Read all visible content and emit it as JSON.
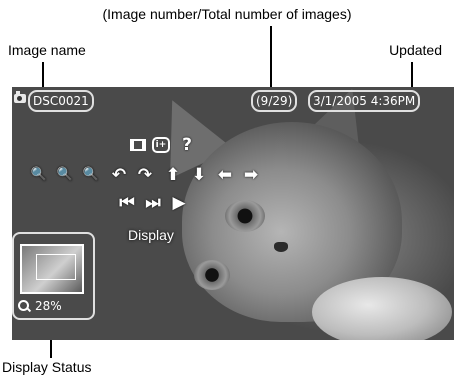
{
  "callouts": {
    "image_number": "(Image number/Total number of images)",
    "image_name": "Image name",
    "updated": "Updated",
    "display_status": "Display Status"
  },
  "status_bar": {
    "camera_icon": "camera-icon",
    "image_name": "DSC0021",
    "image_number": "(9/29)",
    "updated": "3/1/2005 4:36PM"
  },
  "controls": {
    "row1": [
      {
        "icon": "frame-icon"
      },
      {
        "icon": "info-icon",
        "text": "i+"
      },
      {
        "icon": "help-icon",
        "text": "?"
      }
    ],
    "row2": [
      {
        "icon": "zoom-out-icon",
        "text": "🔍"
      },
      {
        "icon": "zoom-reset-icon",
        "text": "🔍"
      },
      {
        "icon": "zoom-in-icon",
        "text": "🔍"
      },
      {
        "icon": "rotate-left-icon",
        "text": "↶"
      },
      {
        "icon": "rotate-right-icon",
        "text": "↷"
      },
      {
        "icon": "arrow-up-icon",
        "text": "⬆"
      },
      {
        "icon": "arrow-down-icon",
        "text": "⬇"
      },
      {
        "icon": "arrow-left-icon",
        "text": "⬅"
      },
      {
        "icon": "arrow-right-icon",
        "text": "➡"
      }
    ],
    "row3": [
      {
        "icon": "previous-icon",
        "text": "⏮"
      },
      {
        "icon": "next-icon",
        "text": "⏭"
      },
      {
        "icon": "play-icon",
        "text": "▶"
      }
    ],
    "selected_label": "Display"
  },
  "display_status": {
    "zoom": "28%"
  }
}
